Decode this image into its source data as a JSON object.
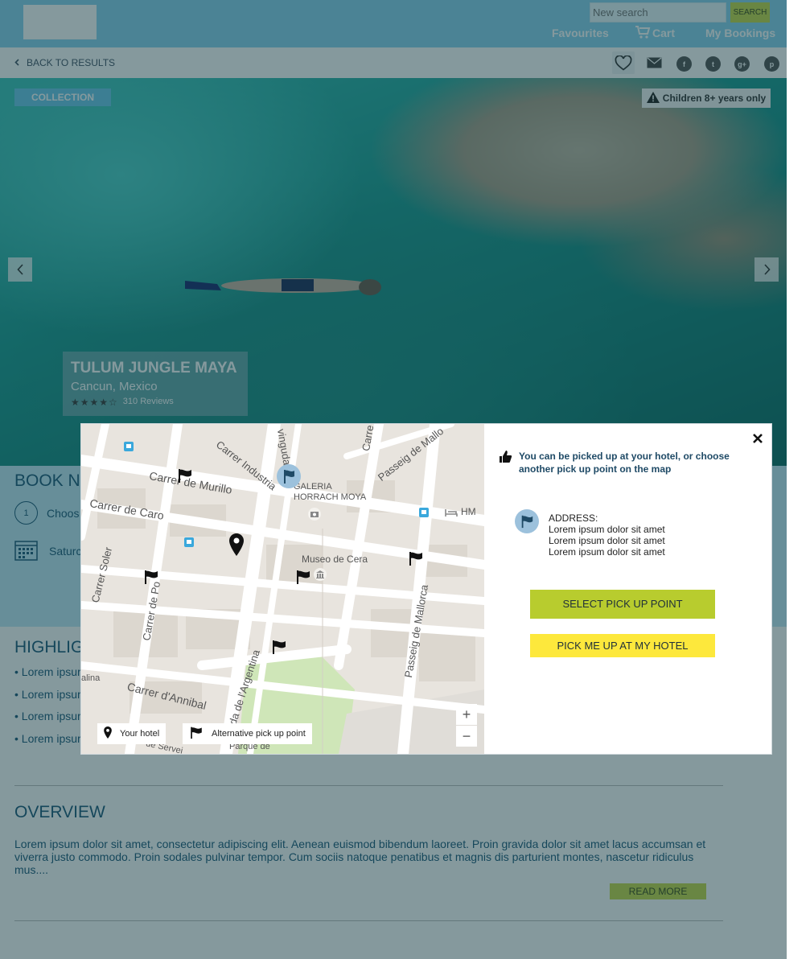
{
  "header": {
    "search_placeholder": "New search",
    "search_button": "SEARCH",
    "nav": {
      "favourites": "Favourites",
      "cart": "Cart",
      "bookings": "My Bookings"
    }
  },
  "subbar": {
    "back_label": "BACK TO RESULTS",
    "social": [
      "f",
      "t",
      "g+",
      "p"
    ]
  },
  "hero": {
    "collection_badge": "COLLECTION",
    "children_badge": "Children 8+ years only",
    "title": "TULUM JUNGLE MAYA",
    "location": "Cancun, Mexico",
    "stars": "★★★★☆",
    "rating": 4.5,
    "reviews": "310 Reviews"
  },
  "booking": {
    "title": "BOOK N",
    "step_number": "1",
    "step_label": "Choos",
    "date_label": "Saturc"
  },
  "highlights": {
    "title": "HIGHLIG",
    "items": [
      "• Lorem ipsur",
      "• Lorem ipsur",
      "• Lorem ipsur",
      "• Lorem ipsur"
    ]
  },
  "overview": {
    "title": "OVERVIEW",
    "text": "Lorem ipsum dolor sit amet, consectetur adipiscing elit. Aenean euismod bibendum laoreet. Proin gravida dolor sit amet lacus accumsan et viverra justo commodo. Proin sodales pulvinar tempor. Cum sociis natoque penatibus et magnis dis parturient montes, nascetur ridiculus mus....",
    "read_more": "READ MORE"
  },
  "map": {
    "labels": {
      "carrer_industria": "Carrer Industria",
      "carrer_murillo": "Carrer de Murillo",
      "carrer_caro": "Carrer de Caro",
      "carrer_soler": "Carrer Soler",
      "carrer_de_po": "Carrer de Po",
      "galeria": "GALERIA",
      "horrach": "HORRACH MOYA",
      "museo": "Museo de Cera",
      "passeig_mallorca": "Passeig de Mallorca",
      "passeig_mallo_top": "Passeig de Mallo",
      "carrer_anibal": "Carrer d'Annibal",
      "argentina": "nguda de l'Argentina",
      "parque": "Parque de",
      "hm": "HM",
      "vinguda": "vinguda de",
      "carre": "Carre",
      "alina": "alina",
      "de_ser": "de Servei"
    },
    "legend": {
      "your_hotel": "Your hotel",
      "alternative": "Alternative pick up point"
    },
    "zoom_in": "+",
    "zoom_out": "−"
  },
  "panel": {
    "info": "You can be picked up at your hotel, or choose another pick up point on the map",
    "address_label": "ADDRESS:",
    "address_lines": [
      "Lorem ipsum dolor sit amet",
      "Lorem ipsum dolor sit amet",
      "Lorem ipsum dolor sit amet"
    ],
    "select_button": "SELECT PICK UP POINT",
    "hotel_button": "PICK ME UP AT MY HOTEL"
  },
  "colors": {
    "header_bg": "#8bd3ef",
    "accent_green": "#b8cc2e",
    "accent_yellow": "#fde83c",
    "overlay": "rgba(12,52,60,0.50)",
    "heading_blue": "#1f5a7a"
  }
}
